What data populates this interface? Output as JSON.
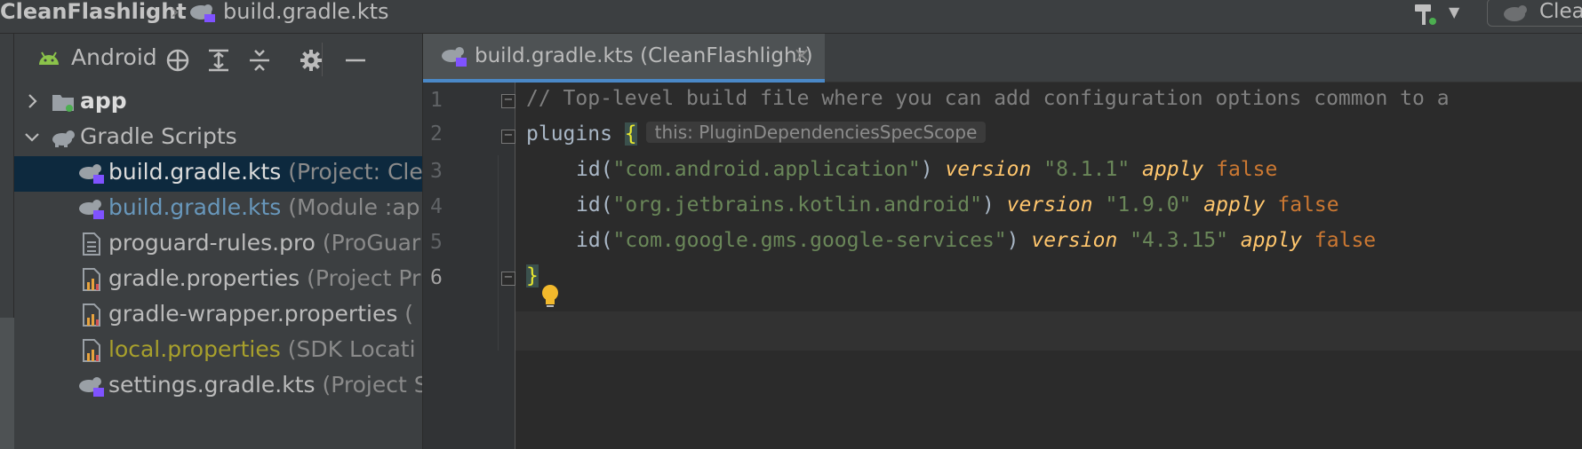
{
  "breadcrumb": {
    "project": "CleanFlashlight",
    "separator": "›",
    "file": "build.gradle.kts"
  },
  "toolbar": {
    "build_icon": "hammer-icon",
    "dropdown_glyph": "▼",
    "run_config_label": "Clea"
  },
  "project_panel": {
    "title": "Android",
    "rows": [
      {
        "name": "app",
        "hint": "",
        "icon": "module-folder-icon",
        "expanded": false
      },
      {
        "name": "Gradle Scripts",
        "hint": "",
        "icon": "gradle-elephant-icon",
        "expanded": true
      },
      {
        "name": "build.gradle.kts",
        "hint": " (Project: Cle",
        "icon": "gradle-kts-icon"
      },
      {
        "name": "build.gradle.kts",
        "hint": " (Module :ap",
        "icon": "gradle-kts-icon"
      },
      {
        "name": "proguard-rules.pro",
        "hint": " (ProGuar",
        "icon": "text-file-icon"
      },
      {
        "name": "gradle.properties",
        "hint": " (Project Pr",
        "icon": "properties-icon"
      },
      {
        "name": "gradle-wrapper.properties",
        "hint": " (",
        "icon": "properties-icon"
      },
      {
        "name": "local.properties",
        "hint": " (SDK Locati",
        "icon": "properties-icon"
      },
      {
        "name": "settings.gradle.kts",
        "hint": " (Project S",
        "icon": "gradle-kts-icon"
      }
    ]
  },
  "editor": {
    "tab_label": "build.gradle.kts (CleanFlashlight)",
    "tab_close": "×",
    "line_numbers": [
      "1",
      "2",
      "3",
      "4",
      "5",
      "6"
    ],
    "lines": {
      "l1_comment": "// Top-level build file where you can add configuration options common to a",
      "l2_plugins": "plugins ",
      "l2_brace": "{",
      "l2_hint": "this: PluginDependenciesSpecScope",
      "l3_id": "id(",
      "l3_str": "\"com.android.application\"",
      "l3_close": ") ",
      "l3_version": "version",
      "l3_vstr": "\"8.1.1\"",
      "l3_apply": "apply",
      "l3_false": "false",
      "l4_id": "id(",
      "l4_str": "\"org.jetbrains.kotlin.android\"",
      "l4_close": ") ",
      "l4_version": "version",
      "l4_vstr": "\"1.9.0\"",
      "l4_apply": "apply",
      "l4_false": "false",
      "l5_id": "id(",
      "l5_str": "\"com.google.gms.google-services\"",
      "l5_close": ") ",
      "l5_version": "version",
      "l5_vstr": "\"4.3.15\"",
      "l5_apply": "apply",
      "l5_false": "false",
      "l6_brace": "}"
    }
  },
  "colors": {
    "accent": "#4a88c7",
    "selection": "#0d293e",
    "string": "#6a8759",
    "keyword": "#cc7832",
    "gradle_green": "#8bc34a"
  }
}
